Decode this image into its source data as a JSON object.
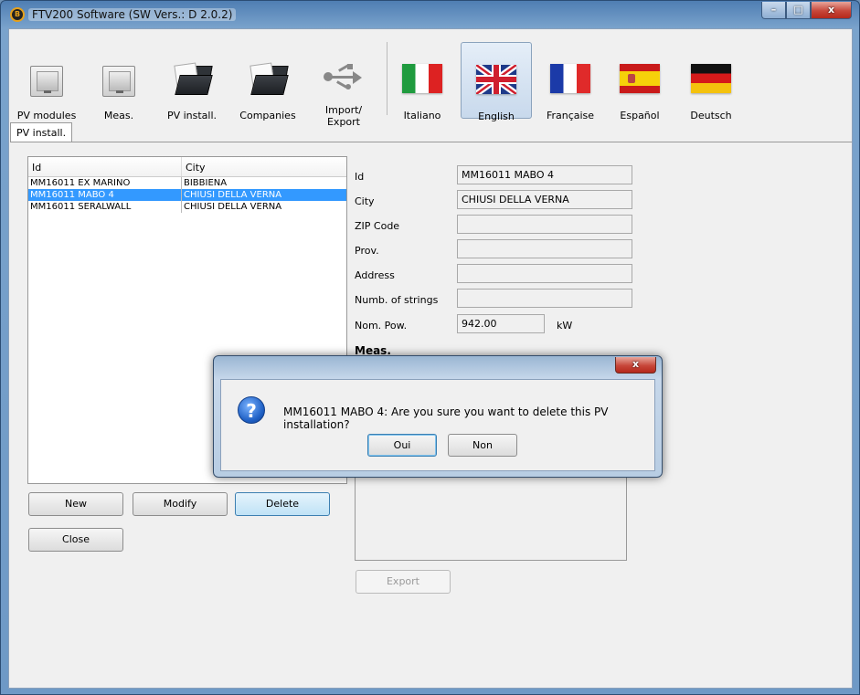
{
  "window": {
    "title": "FTV200 Software (SW Vers.: D 2.0.2)",
    "app_icon": "FTV-logo-icon",
    "controls": {
      "minimize": "–",
      "maximize": "□",
      "close": "x"
    }
  },
  "toolbar": {
    "items": [
      {
        "label": "PV modules",
        "icon": "file-cabinet-icon"
      },
      {
        "label": "Meas.",
        "icon": "file-cabinet-icon"
      },
      {
        "label": "PV install.",
        "icon": "folder-icon"
      },
      {
        "label": "Companies",
        "icon": "folder-icon"
      },
      {
        "label": "Import/\nExport",
        "icon": "usb-icon"
      },
      {
        "label": "Italiano",
        "icon": "flag-italy-icon"
      },
      {
        "label": "English",
        "icon": "flag-uk-icon",
        "active": true
      },
      {
        "label": "Française",
        "icon": "flag-france-icon"
      },
      {
        "label": "Español",
        "icon": "flag-spain-icon"
      },
      {
        "label": "Deutsch",
        "icon": "flag-germany-icon"
      }
    ]
  },
  "tab": {
    "label": "PV install."
  },
  "table": {
    "columns": [
      "Id",
      "City"
    ],
    "rows": [
      {
        "id": "MM16011 EX MARINO",
        "city": "BIBBIENA"
      },
      {
        "id": "MM16011 MABO 4",
        "city": "CHIUSI DELLA VERNA",
        "selected": true
      },
      {
        "id": "MM16011 SERALWALL",
        "city": "CHIUSI DELLA VERNA"
      }
    ]
  },
  "buttons": {
    "new": "New",
    "modify": "Modify",
    "delete": "Delete",
    "close": "Close",
    "export": "Export"
  },
  "form": {
    "id_label": "Id",
    "id_value": "MM16011 MABO 4",
    "city_label": "City",
    "city_value": "CHIUSI DELLA VERNA",
    "zip_label": "ZIP Code",
    "zip_value": "",
    "prov_label": "Prov.",
    "prov_value": "",
    "address_label": "Address",
    "address_value": "",
    "strings_label": "Numb. of strings",
    "strings_value": "",
    "pow_label": "Nom. Pow.",
    "pow_value": "942.00",
    "pow_unit": "kW",
    "meas_title": "Meas."
  },
  "dialog": {
    "message": "MM16011 MABO 4: Are you sure you want to delete this PV installation?",
    "yes": "Oui",
    "no": "Non",
    "close": "x",
    "icon": "question-icon"
  },
  "colors": {
    "selection": "#3399ff",
    "title_bar": "#6e99c6",
    "hot_button": "#bfe2f6"
  }
}
